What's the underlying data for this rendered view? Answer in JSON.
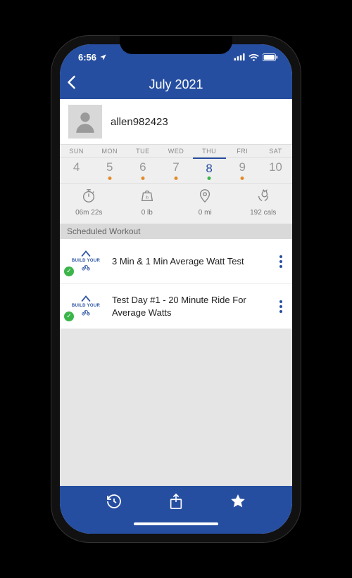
{
  "status": {
    "time": "6:56"
  },
  "nav": {
    "title": "July 2021"
  },
  "profile": {
    "username": "allen982423"
  },
  "week": {
    "labels": [
      "SUN",
      "MON",
      "TUE",
      "WED",
      "THU",
      "FRI",
      "SAT"
    ],
    "days": [
      {
        "n": "4",
        "selected": false,
        "dot": null
      },
      {
        "n": "5",
        "selected": false,
        "dot": "orange"
      },
      {
        "n": "6",
        "selected": false,
        "dot": "orange"
      },
      {
        "n": "7",
        "selected": false,
        "dot": "orange"
      },
      {
        "n": "8",
        "selected": true,
        "dot": "green"
      },
      {
        "n": "9",
        "selected": false,
        "dot": "orange"
      },
      {
        "n": "10",
        "selected": false,
        "dot": null
      }
    ]
  },
  "stats": {
    "duration": "06m 22s",
    "weight": "0 lb",
    "distance": "0 mi",
    "calories": "192 cals"
  },
  "section_title": "Scheduled Workout",
  "workouts": [
    {
      "brand": "BUILD YOUR",
      "title": "3 Min & 1 Min Average Watt Test",
      "completed": true
    },
    {
      "brand": "BUILD YOUR",
      "title": "Test Day #1 - 20 Minute Ride For Average Watts",
      "completed": true
    }
  ]
}
